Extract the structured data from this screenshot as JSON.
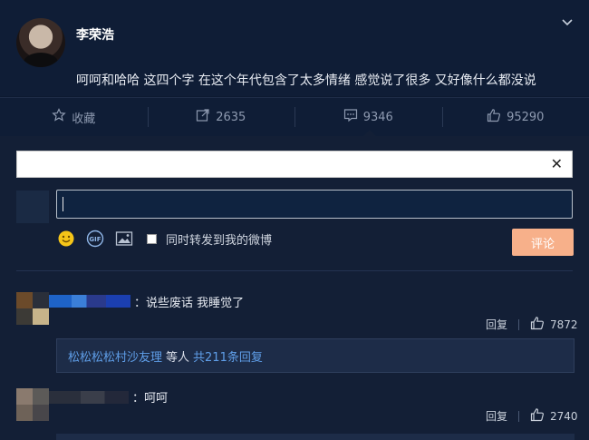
{
  "post": {
    "username": "李荣浩",
    "text": "呵呵和哈哈 这四个字 在这个年代包含了太多情绪 感觉说了很多 又好像什么都没说"
  },
  "actions": [
    {
      "icon": "star-icon",
      "label": "收藏"
    },
    {
      "icon": "repost-icon",
      "label": "2635"
    },
    {
      "icon": "comment-icon",
      "label": "9346"
    },
    {
      "icon": "thumbs-up-icon",
      "label": "95290"
    }
  ],
  "comment_box": {
    "repost_label": "同时转发到我的微博",
    "submit_label": "评论"
  },
  "comments": [
    {
      "text": "：说些废话  我睡觉了",
      "reply_label": "回复",
      "likes": "7872"
    },
    {
      "text": "：呵呵",
      "reply_label": "回复",
      "likes": "2740"
    }
  ],
  "reply_summary": {
    "user": "松松松松村沙友理",
    "middle": " 等人 ",
    "count": "共211条回复"
  },
  "colors": {
    "background": "#0d1a30",
    "panel": "#131f36",
    "link": "#5f9ee8",
    "submit": "#f7b08a"
  }
}
